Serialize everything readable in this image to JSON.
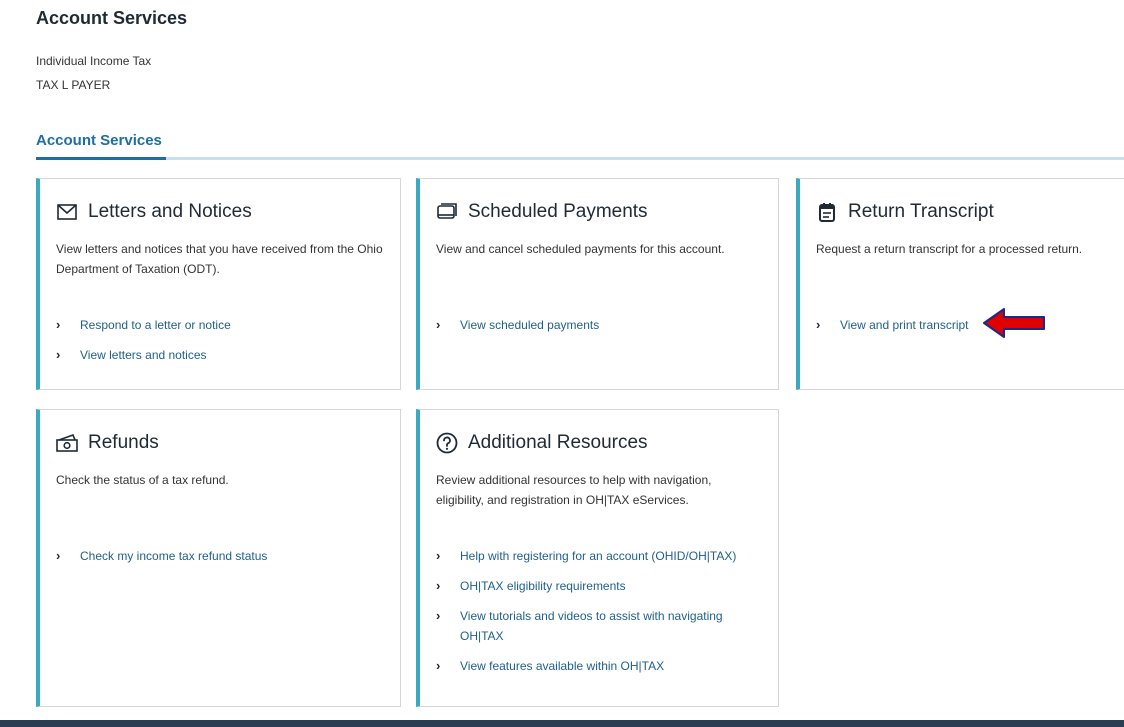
{
  "header": {
    "title": "Account Services",
    "account_type": "Individual Income Tax",
    "account_name": "TAX L PAYER"
  },
  "tabs": [
    {
      "label": "Account Services",
      "active": true
    }
  ],
  "cards": {
    "letters": {
      "title": "Letters and Notices",
      "icon": "envelope-icon",
      "description": "View letters and notices that you have received from the Ohio Department of Taxation (ODT).",
      "links": [
        "Respond to a letter or notice",
        "View letters and notices"
      ]
    },
    "scheduled": {
      "title": "Scheduled Payments",
      "icon": "payments-icon",
      "description": "View and cancel scheduled payments for this account.",
      "links": [
        "View scheduled payments"
      ]
    },
    "transcript": {
      "title": "Return Transcript",
      "icon": "document-icon",
      "description": "Request a return transcript for a processed return.",
      "links": [
        "View and print transcript"
      ]
    },
    "refunds": {
      "title": "Refunds",
      "icon": "cash-icon",
      "description": "Check the status of a tax refund.",
      "links": [
        "Check my income tax refund status"
      ]
    },
    "resources": {
      "title": "Additional Resources",
      "icon": "question-circle-icon",
      "description": "Review additional resources to help with navigation, eligibility, and registration in OH|TAX eServices.",
      "links": [
        "Help with registering for an account (OHID/OH|TAX)",
        "OH|TAX eligibility requirements",
        "View tutorials and videos to assist with navigating OH|TAX",
        "View features available within OH|TAX"
      ]
    }
  },
  "colors": {
    "accent": "#3aaabf",
    "tab_active": "#1e6fa0",
    "link": "#1f5f8b",
    "annotation_arrow": "#e00000",
    "bottom_bar": "#2a3d55"
  }
}
